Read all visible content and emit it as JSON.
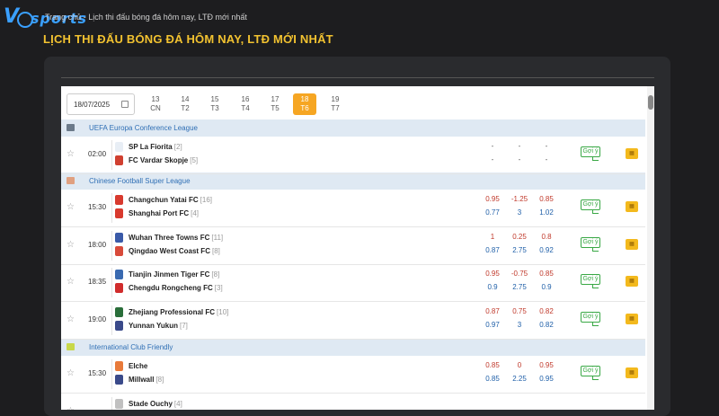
{
  "breadcrumb": {
    "home": "Trang chủ",
    "separator": "-",
    "current": "Lịch thi đấu bóng đá hôm nay, LTĐ mới nhất"
  },
  "page": {
    "title": "LỊCH THI ĐẤU BÓNG ĐÁ HÔM NAY, LTĐ MỚI NHẤT"
  },
  "brand": {
    "logo_text": "V sports"
  },
  "datepicker": {
    "value": "18/07/2025",
    "icon": "calendar-icon"
  },
  "days": [
    {
      "num": "13",
      "dow": "CN"
    },
    {
      "num": "14",
      "dow": "T2"
    },
    {
      "num": "15",
      "dow": "T3"
    },
    {
      "num": "16",
      "dow": "T4"
    },
    {
      "num": "17",
      "dow": "T5"
    },
    {
      "num": "18",
      "dow": "T6",
      "active": true
    },
    {
      "num": "19",
      "dow": "T7"
    }
  ],
  "leagues": [
    {
      "name": "UEFA Europa Conference League"
    },
    {
      "name": "Chinese Football Super League"
    },
    {
      "name": "International Club Friendly"
    }
  ],
  "matches": [
    {
      "time": "02:00",
      "home": "SP La Fiorita",
      "home_rank": "[2]",
      "away": "FC Vardar Skopje",
      "away_rank": "[5]",
      "odds_top": [
        "-",
        "-",
        "-"
      ],
      "odds_bottom": [
        "-",
        "-",
        "-"
      ],
      "tip": "Gợi ý"
    },
    {
      "time": "15:30",
      "home": "Changchun Yatai FC",
      "home_rank": "[16]",
      "away": "Shanghai Port FC",
      "away_rank": "[4]",
      "odds_top": [
        "0.95",
        "-1.25",
        "0.85"
      ],
      "odds_bottom": [
        "0.77",
        "3",
        "1.02"
      ],
      "tip": "Gợi ý"
    },
    {
      "time": "18:00",
      "home": "Wuhan Three Towns FC",
      "home_rank": "[11]",
      "away": "Qingdao West Coast FC",
      "away_rank": "[8]",
      "odds_top": [
        "1",
        "0.25",
        "0.8"
      ],
      "odds_bottom": [
        "0.87",
        "2.75",
        "0.92"
      ],
      "tip": "Gợi ý"
    },
    {
      "time": "18:35",
      "home": "Tianjin Jinmen Tiger FC",
      "home_rank": "[8]",
      "away": "Chengdu Rongcheng FC",
      "away_rank": "[3]",
      "odds_top": [
        "0.95",
        "-0.75",
        "0.85"
      ],
      "odds_bottom": [
        "0.9",
        "2.75",
        "0.9"
      ],
      "tip": "Gợi ý"
    },
    {
      "time": "19:00",
      "home": "Zhejiang Professional FC",
      "home_rank": "[10]",
      "away": "Yunnan Yukun",
      "away_rank": "[7]",
      "odds_top": [
        "0.87",
        "0.75",
        "0.82"
      ],
      "odds_bottom": [
        "0.97",
        "3",
        "0.82"
      ],
      "tip": "Gợi ý"
    },
    {
      "time": "15:30",
      "home": "Elche",
      "home_rank": "",
      "away": "Millwall",
      "away_rank": "[8]",
      "odds_top": [
        "0.85",
        "0",
        "0.95"
      ],
      "odds_bottom": [
        "0.85",
        "2.25",
        "0.95"
      ],
      "tip": "Gợi ý"
    },
    {
      "time": "",
      "home": "Stade Ouchy",
      "home_rank": "[4]",
      "away": "",
      "away_rank": "",
      "odds_top": [
        "",
        "",
        ""
      ],
      "odds_bottom": [
        "",
        "",
        ""
      ],
      "tip": ""
    }
  ],
  "colors": {
    "accent_title": "#f2c230",
    "league_bar": "#dfe9f3",
    "league_text": "#2f6fb5",
    "active_day": "#f6a623",
    "odds_red": "#c0392b",
    "odds_blue": "#1f5fa8",
    "tip_green": "#39a845"
  }
}
